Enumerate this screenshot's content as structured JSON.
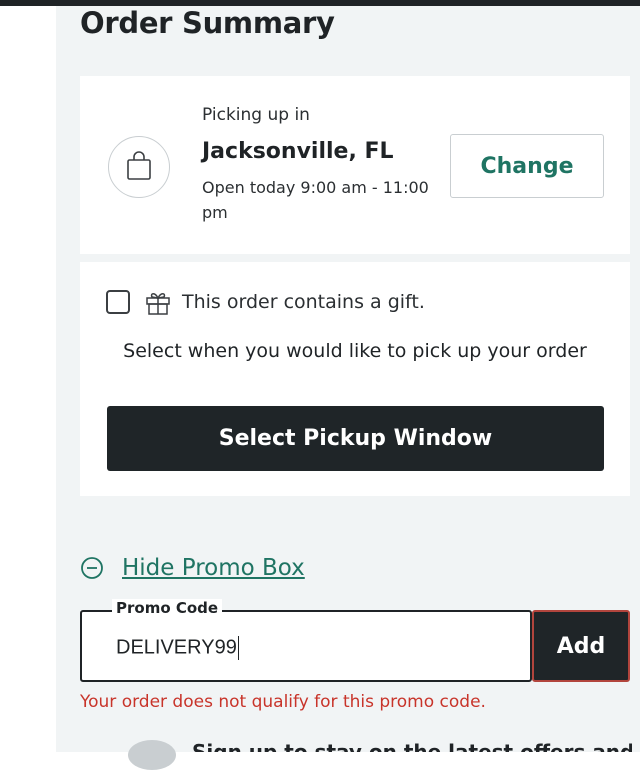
{
  "order_summary": {
    "title": "Order Summary"
  },
  "pickup": {
    "label": "Picking up in",
    "city": "Jacksonville, FL",
    "hours": "Open today 9:00 am - 11:00 pm",
    "change_label": "Change",
    "icon": "shopping-bag-icon"
  },
  "gift": {
    "checked": false,
    "icon": "gift-icon",
    "label": "This order contains a gift."
  },
  "pickup_window": {
    "prompt": "Select when you would like to pick up your order",
    "button_label": "Select Pickup Window"
  },
  "promo": {
    "toggle_icon": "minus-circle-icon",
    "toggle_label": "Hide Promo Box",
    "field_label": "Promo Code",
    "value": "DELIVERY99",
    "add_label": "Add",
    "error": "Your order does not qualify for this promo code."
  },
  "signup": {
    "text": "Sign up to stay on the latest offers and news"
  },
  "colors": {
    "accent": "#1f7463",
    "dark": "#1f2528",
    "error": "#c8342a",
    "panel_bg": "#f1f4f5"
  }
}
